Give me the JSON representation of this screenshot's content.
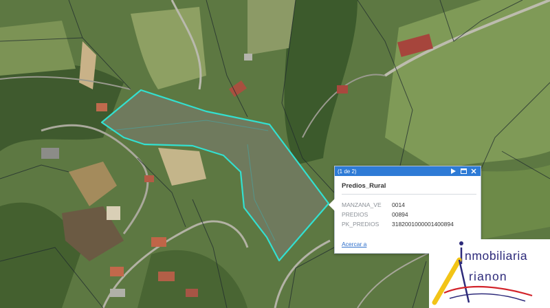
{
  "popup": {
    "counter": "(1 de 2)",
    "title": "Predios_Rural",
    "attributes": [
      {
        "name": "MANZANA_VE",
        "value": "0014"
      },
      {
        "name": "PREDIOS",
        "value": "00894"
      },
      {
        "name": "PK_PREDIOS",
        "value": "318200100000140089­4"
      }
    ],
    "link_label": "Acercar a",
    "header_color": "#2e7bd6"
  },
  "logo": {
    "line1_rest": "nmobiliaria",
    "line2_rest": "rianon",
    "text_color": "#2d2a7a",
    "accent_colors": [
      "#f2c417",
      "#d2232a",
      "#2d2a7a"
    ]
  },
  "map": {
    "parcel_outline_color": "#33e0d0"
  }
}
